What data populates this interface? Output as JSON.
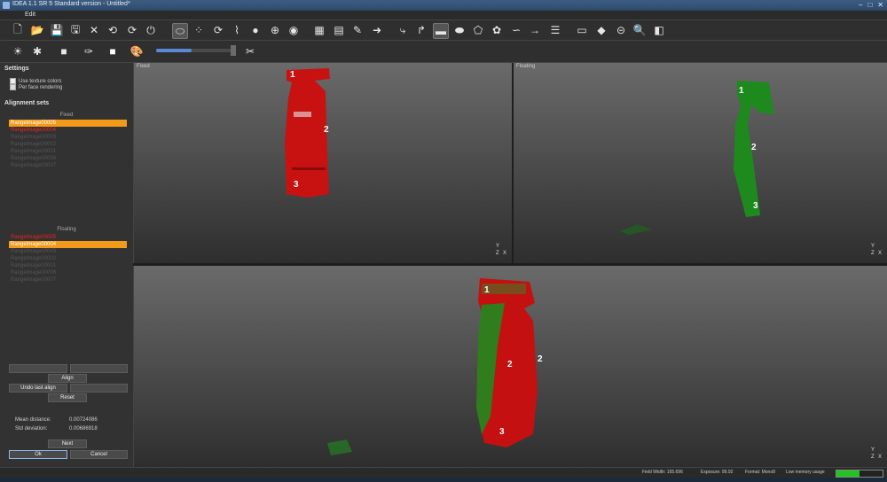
{
  "window": {
    "title": "IDEA 1.1 SR 5 Standard version - Untitled*",
    "buttons": [
      "–",
      "□",
      "✕"
    ]
  },
  "menu": {
    "items": [
      "Edit"
    ]
  },
  "toolbar1": {
    "icons": [
      "new-icon",
      "open-icon",
      "save-icon",
      "save-as-icon",
      "delete-icon",
      "undo-icon",
      "redo-icon",
      "power-icon",
      "cylinder-icon",
      "points-icon",
      "rotate-icon",
      "measure-icon",
      "sphere-icon",
      "globe-icon",
      "circle-icon",
      "grid-icon",
      "grid2-icon",
      "brush-icon",
      "arrow-right-icon",
      "hook-icon",
      "curve-icon",
      "rectangle-icon",
      "ellipse-icon",
      "polygon-icon",
      "lasso-icon",
      "line-curve-icon",
      "arrow-icon",
      "list-icon",
      "panel-icon",
      "diamond-icon",
      "plane-icon",
      "magnify-icon",
      "cube-icon"
    ]
  },
  "toolbar2": {
    "icons": [
      "light-icon",
      "bug-icon",
      "stop-icon",
      "wand-icon",
      "white-square-icon",
      "palette-icon",
      "slider-icon",
      "tools-icon"
    ]
  },
  "sidebar": {
    "settings_title": "Settings",
    "opt1": "Use texture colors",
    "opt2": "Per face rendering",
    "alignment_title": "Alignment sets",
    "fixed_label": "Fixed",
    "fixed_items": [
      "RangeImage00005",
      "RangeImage00004",
      "RangeImage00003",
      "RangeImage00002",
      "RangeImage00001",
      "RangeImage00006",
      "RangeImage00007"
    ],
    "floating_label": "Floating",
    "floating_items": [
      "RangeImage00005",
      "RangeImage00004",
      "RangeImage00003",
      "RangeImage00002",
      "RangeImage00001",
      "RangeImage00006",
      "RangeImage00007"
    ],
    "align_button": "Align",
    "undo_button": "Undo last align",
    "reset_button": "Reset",
    "mean_label": "Mean distance:",
    "mean_value": "0.00724086",
    "std_label": "Std deviation:",
    "std_value": "0.00686918",
    "next_button": "Next",
    "ok_button": "Ok",
    "cancel_button": "Cancel"
  },
  "views": {
    "fixed_label": "Fixed",
    "floating_label": "Floating",
    "axis_y": "Y",
    "axis_z": "Z",
    "axis_x": "X",
    "markers": [
      "1",
      "2",
      "3"
    ]
  },
  "status": {
    "field_width": "Field Width: 165.696",
    "exposure": "Exposure: 99.92",
    "format": "Format: Mono8",
    "memory": "Low memory usage",
    "memory_level": 0.5
  },
  "colors": {
    "selected": "#f39a1a",
    "red_scan": "#cc1010",
    "green_scan": "#1e8a1e"
  }
}
